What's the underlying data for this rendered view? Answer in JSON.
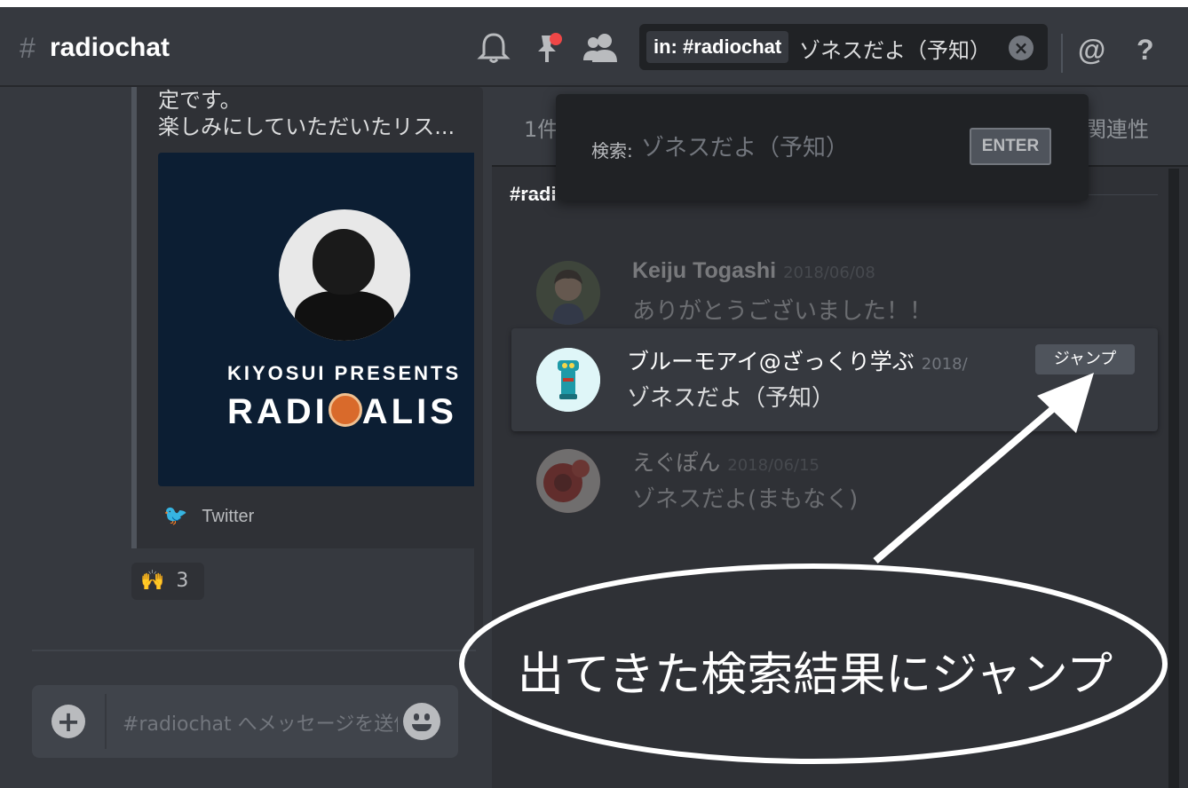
{
  "header": {
    "hash": "#",
    "channel": "radiochat",
    "icons": [
      "bell-icon",
      "pin-icon",
      "members-icon"
    ],
    "search_chip": "in: #radiochat",
    "search_query": "ゾネスだよ（予知）",
    "at_icon": "@",
    "help_icon": "?",
    "colors": {
      "pin_badge": "#f04747",
      "bg": "#36393f"
    }
  },
  "left": {
    "embed_lines": [
      "定です。",
      "楽しみにしていただいたリス..."
    ],
    "image_presents": "KIYOSUI PRESENTS",
    "image_logo_left": "RADI",
    "image_logo_right": "ALIS",
    "twitter_label": "Twitter",
    "reaction_emoji": "🙌",
    "reaction_count": "3",
    "input_placeholder": "#radiochat へメッセージを送信"
  },
  "search": {
    "results_count": "1件",
    "sort_label": "関連性",
    "channel_heading": "#radiochat",
    "popout_label": "検索:",
    "popout_query": "ゾネスだよ（予知）",
    "enter_label": "ENTER",
    "results": [
      {
        "author": "Keiju Togashi",
        "date": "2018/06/08",
        "text": "ありがとうございました！！"
      },
      {
        "author": "ブルーモアイ@ざっくり学ぶ",
        "date": "2018/",
        "text": "ゾネスだよ（予知）",
        "jump_label": "ジャンプ"
      },
      {
        "author": "えぐぽん",
        "date": "2018/06/15",
        "text": "ゾネスだよ(まもなく)"
      }
    ]
  },
  "annotation": {
    "text": "出てきた検索結果にジャンプ"
  }
}
